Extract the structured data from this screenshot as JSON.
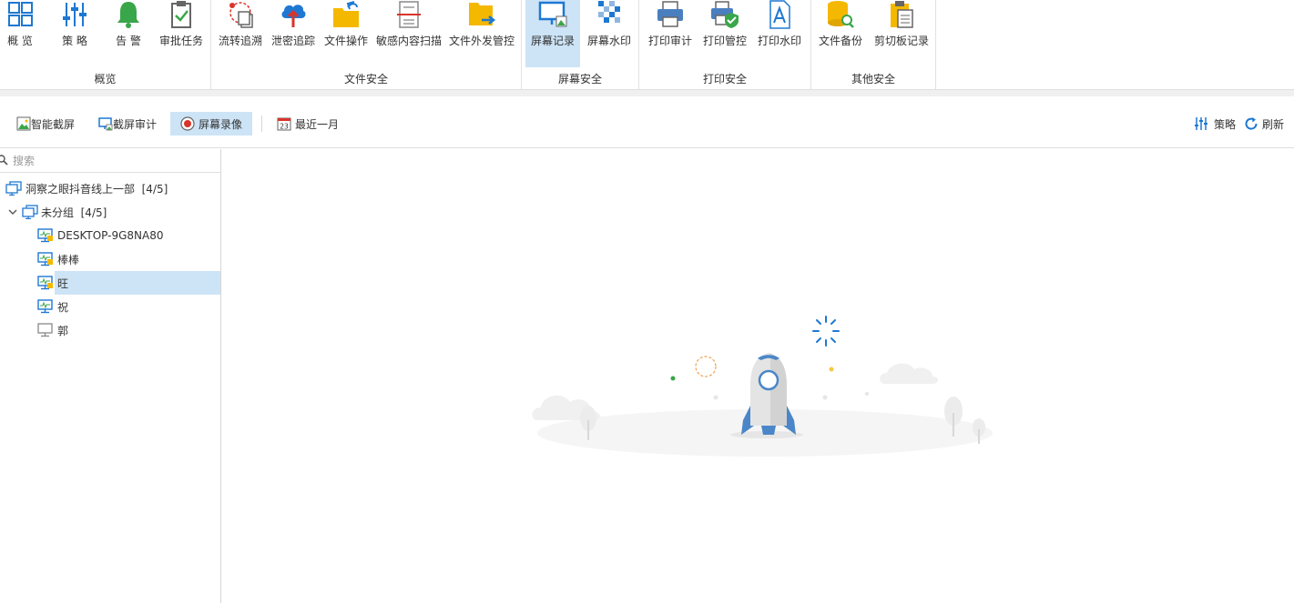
{
  "ribbon": {
    "groups": [
      {
        "label": "概览",
        "buttons": [
          {
            "label": "概 览",
            "icon": "overview-grid-icon"
          },
          {
            "label": "策 略",
            "icon": "strategy-sliders-icon"
          },
          {
            "label": "告 警",
            "icon": "alarm-bell-icon"
          },
          {
            "label": "审批任务",
            "icon": "approval-clipboard-icon"
          }
        ]
      },
      {
        "label": "文件安全",
        "buttons": [
          {
            "label": "流转追溯",
            "icon": "flow-trace-icon"
          },
          {
            "label": "泄密追踪",
            "icon": "leak-track-cloud-icon"
          },
          {
            "label": "文件操作",
            "icon": "file-operation-folder-icon"
          },
          {
            "label": "敏感内容扫描",
            "icon": "sensitive-scan-icon"
          },
          {
            "label": "文件外发管控",
            "icon": "file-outgoing-folder-icon"
          }
        ]
      },
      {
        "label": "屏幕安全",
        "buttons": [
          {
            "label": "屏幕记录",
            "icon": "screen-record-icon"
          },
          {
            "label": "屏幕水印",
            "icon": "screen-watermark-icon"
          }
        ]
      },
      {
        "label": "打印安全",
        "buttons": [
          {
            "label": "打印审计",
            "icon": "print-audit-icon"
          },
          {
            "label": "打印管控",
            "icon": "print-control-icon"
          },
          {
            "label": "打印水印",
            "icon": "print-watermark-icon"
          }
        ]
      },
      {
        "label": "其他安全",
        "buttons": [
          {
            "label": "文件备份",
            "icon": "file-backup-icon"
          },
          {
            "label": "剪切板记录",
            "icon": "clipboard-record-icon"
          }
        ]
      }
    ]
  },
  "toolbar": {
    "smart_capture": "智能截屏",
    "capture_audit": "截屏审计",
    "screen_video": "屏幕录像",
    "date_range": "最近一月",
    "calendar_day": "23",
    "strategy": "策略",
    "refresh": "刷新"
  },
  "sidebar": {
    "search_placeholder": "搜索",
    "tree": [
      {
        "label": "洞察之眼抖音线上一部  [4/5]",
        "level": 0,
        "type": "group-root"
      },
      {
        "label": "未分组  [4/5]",
        "level": 1,
        "type": "group",
        "expanded": true
      },
      {
        "label": "DESKTOP-9G8NA80",
        "level": 2,
        "type": "online"
      },
      {
        "label": "棒棒",
        "level": 2,
        "type": "online"
      },
      {
        "label": "旺",
        "level": 2,
        "type": "online",
        "selected": true
      },
      {
        "label": "祝",
        "level": 2,
        "type": "online"
      },
      {
        "label": "郭",
        "level": 2,
        "type": "offline"
      }
    ]
  },
  "colors": {
    "accent": "#1e78d2",
    "selected_bg": "#cde4f7",
    "folder": "#f5b800",
    "alarm_green": "#3aa64a",
    "record_red": "#d9342b"
  }
}
